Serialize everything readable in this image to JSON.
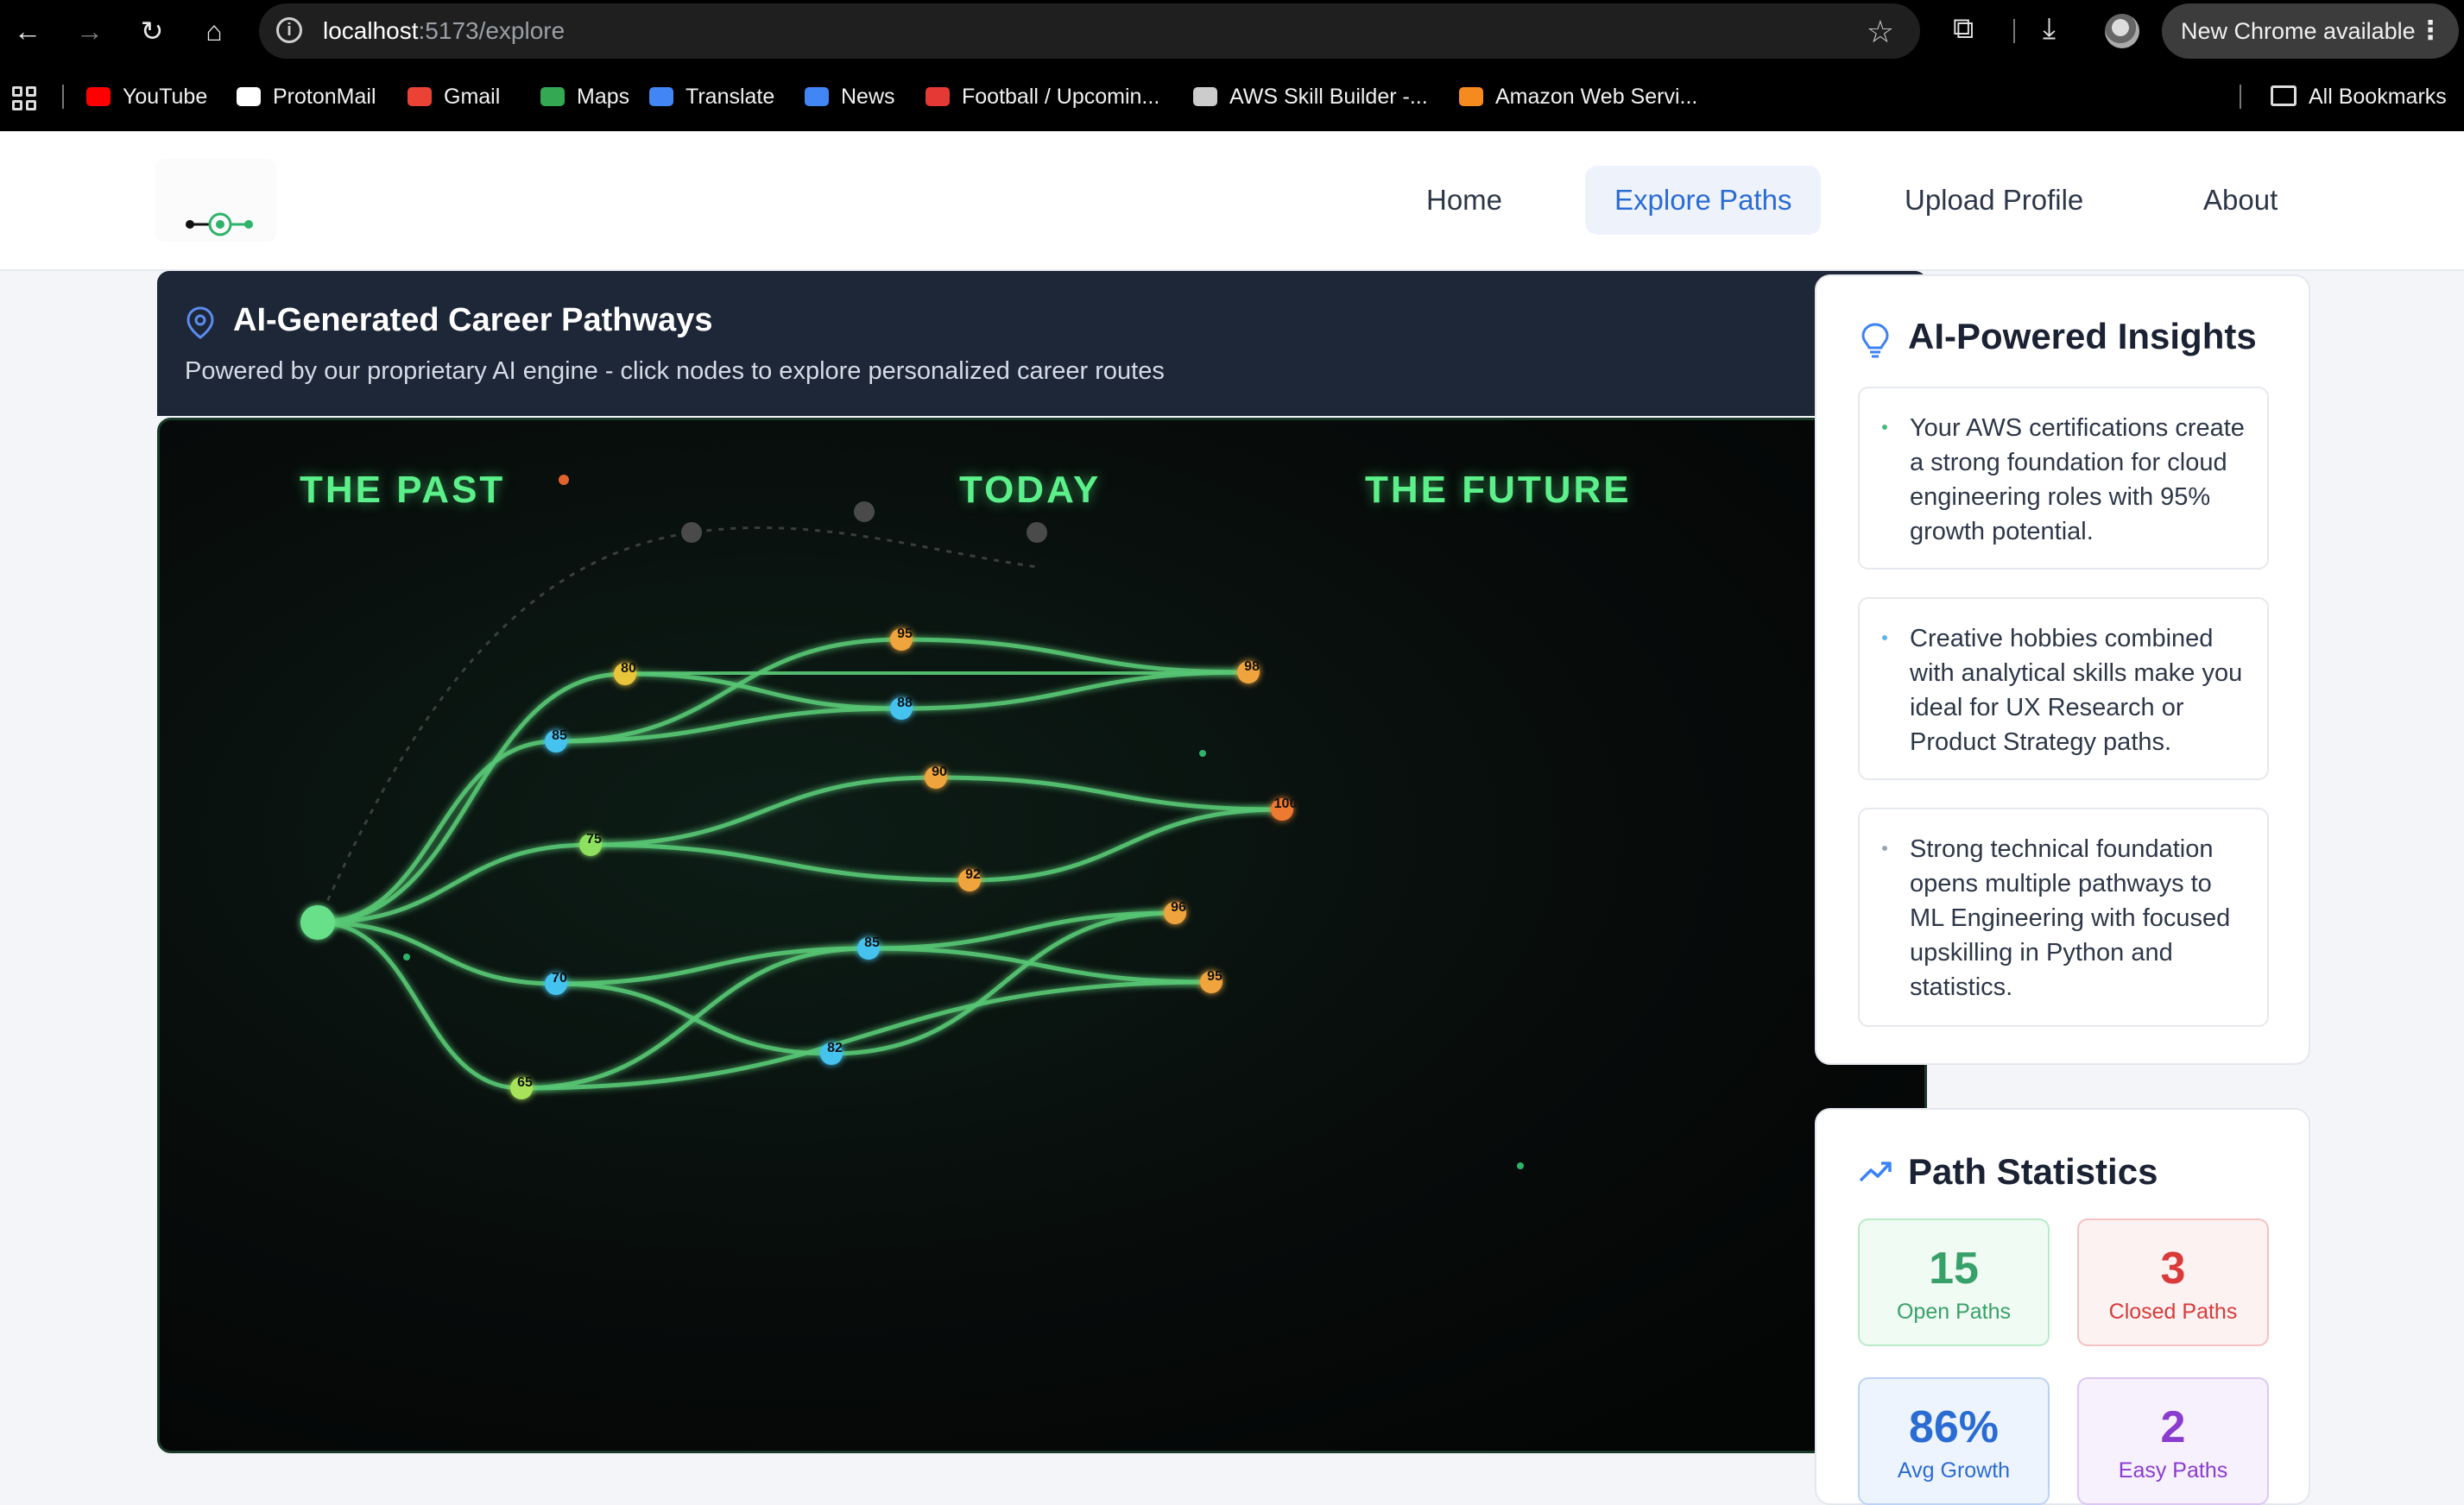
{
  "browser": {
    "url_host": "localhost",
    "url_rest": ":5173/explore",
    "new_chrome": "New Chrome available",
    "bookmarks": [
      {
        "label": "YouTube",
        "color": "#ff0000"
      },
      {
        "label": "ProtonMail",
        "color": "#ffffff"
      },
      {
        "label": "Gmail",
        "color": "#ea4335"
      },
      {
        "label": "Maps",
        "color": "#34a853"
      },
      {
        "label": "Translate",
        "color": "#4285f4"
      },
      {
        "label": "News",
        "color": "#4285f4"
      },
      {
        "label": "Football / Upcomin...",
        "color": "#e53935"
      },
      {
        "label": "AWS Skill Builder -...",
        "color": "#cccccc"
      },
      {
        "label": "Amazon Web Servi...",
        "color": "#f58b1f"
      }
    ],
    "all_bookmarks": "All Bookmarks"
  },
  "nav": {
    "items": [
      "Home",
      "Explore Paths",
      "Upload Profile",
      "About"
    ],
    "active": "Explore Paths"
  },
  "pathways": {
    "title": "AI-Generated Career Pathways",
    "subtitle": "Powered by our proprietary AI engine - click nodes to explore personalized career routes",
    "eras": [
      "THE PAST",
      "TODAY",
      "THE FUTURE"
    ],
    "node_scores": [
      "80",
      "85",
      "95",
      "88",
      "98",
      "90",
      "100",
      "75",
      "92",
      "96",
      "70",
      "85",
      "95",
      "82",
      "65"
    ]
  },
  "insights": {
    "title": "AI-Powered Insights",
    "items": [
      {
        "text": "Your AWS certifications create a strong foundation for cloud engineering roles with 95% growth potential.",
        "color": "#48bb78"
      },
      {
        "text": "Creative hobbies combined with analytical skills make you ideal for UX Research or Product Strategy paths.",
        "color": "#63b3ed"
      },
      {
        "text": "Strong technical foundation opens multiple pathways to ML Engineering with focused upskilling in Python and statistics.",
        "color": "#9aa5b1"
      }
    ]
  },
  "stats": {
    "title": "Path Statistics",
    "items": [
      {
        "value": "15",
        "label": "Open Paths",
        "color": "#38a169",
        "bg": "#f0fbf3",
        "border": "#b9ebc8"
      },
      {
        "value": "3",
        "label": "Closed Paths",
        "color": "#d93a3a",
        "bg": "#fdf2f2",
        "border": "#f5c1c1"
      },
      {
        "value": "86%",
        "label": "Avg Growth",
        "color": "#2b6cd3",
        "bg": "#eef4fd",
        "border": "#bcd3f5"
      },
      {
        "value": "2",
        "label": "Easy Paths",
        "color": "#8a3ccf",
        "bg": "#f7f0fd",
        "border": "#dcc7f3"
      }
    ]
  }
}
